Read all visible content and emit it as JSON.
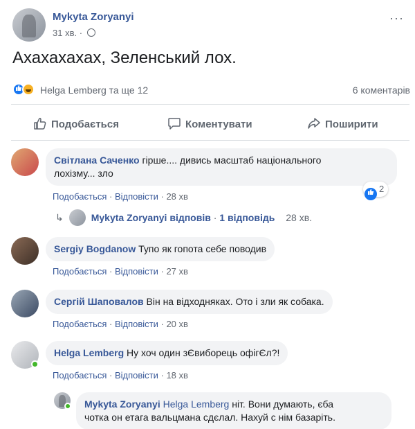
{
  "post": {
    "author": "Mykyta Zoryanyi",
    "time": "31 хв. ·",
    "text": "Ахахахахах, Зеленський лох.",
    "more": "···"
  },
  "reactions": {
    "names": "Helga Lemberg та ще 12",
    "comments_count": "6 коментарів",
    "icons": [
      "like-icon",
      "haha-icon"
    ]
  },
  "actions": {
    "like": "Подобається",
    "comment": "Коментувати",
    "share": "Поширити"
  },
  "comments": [
    {
      "author": "Світлана Саченко",
      "text": " гірше.... дивись масштаб національного",
      "text2": "лохізму... зло",
      "like": "Подобається",
      "reply": "Відповісти",
      "time": "28 хв",
      "reaction_count": "2"
    },
    {
      "author": "Sergiy Bogdanow",
      "text": " Тупо як гопота себе поводив",
      "like": "Подобається",
      "reply": "Відповісти",
      "time": "27 хв"
    },
    {
      "author": "Сергій Шаповалов",
      "text": " Він на відходняках. Ото і зли як собака.",
      "like": "Подобається",
      "reply": "Відповісти",
      "time": "20 хв"
    },
    {
      "author": "Helga Lemberg",
      "text": " Ну хоч один зЄвиборець офігЄл?!",
      "like": "Подобається",
      "reply": "Відповісти",
      "time": "18 хв"
    }
  ],
  "reply_summary": {
    "who": "Mykyta Zoryanyi відповів",
    "count": "1 відповідь",
    "time": "28 хв."
  },
  "nested_reply": {
    "author": "Mykyta Zoryanyi",
    "mention": "Helga Lemberg",
    "text": " ніт. Вони думають, єба",
    "text2": "чотка он етага вальцмана сдєлал. Нахуй с нім базаріть."
  },
  "colors": {
    "link": "#385898",
    "bubble": "#f2f3f5",
    "meta": "#616770",
    "online": "#42b72a"
  }
}
